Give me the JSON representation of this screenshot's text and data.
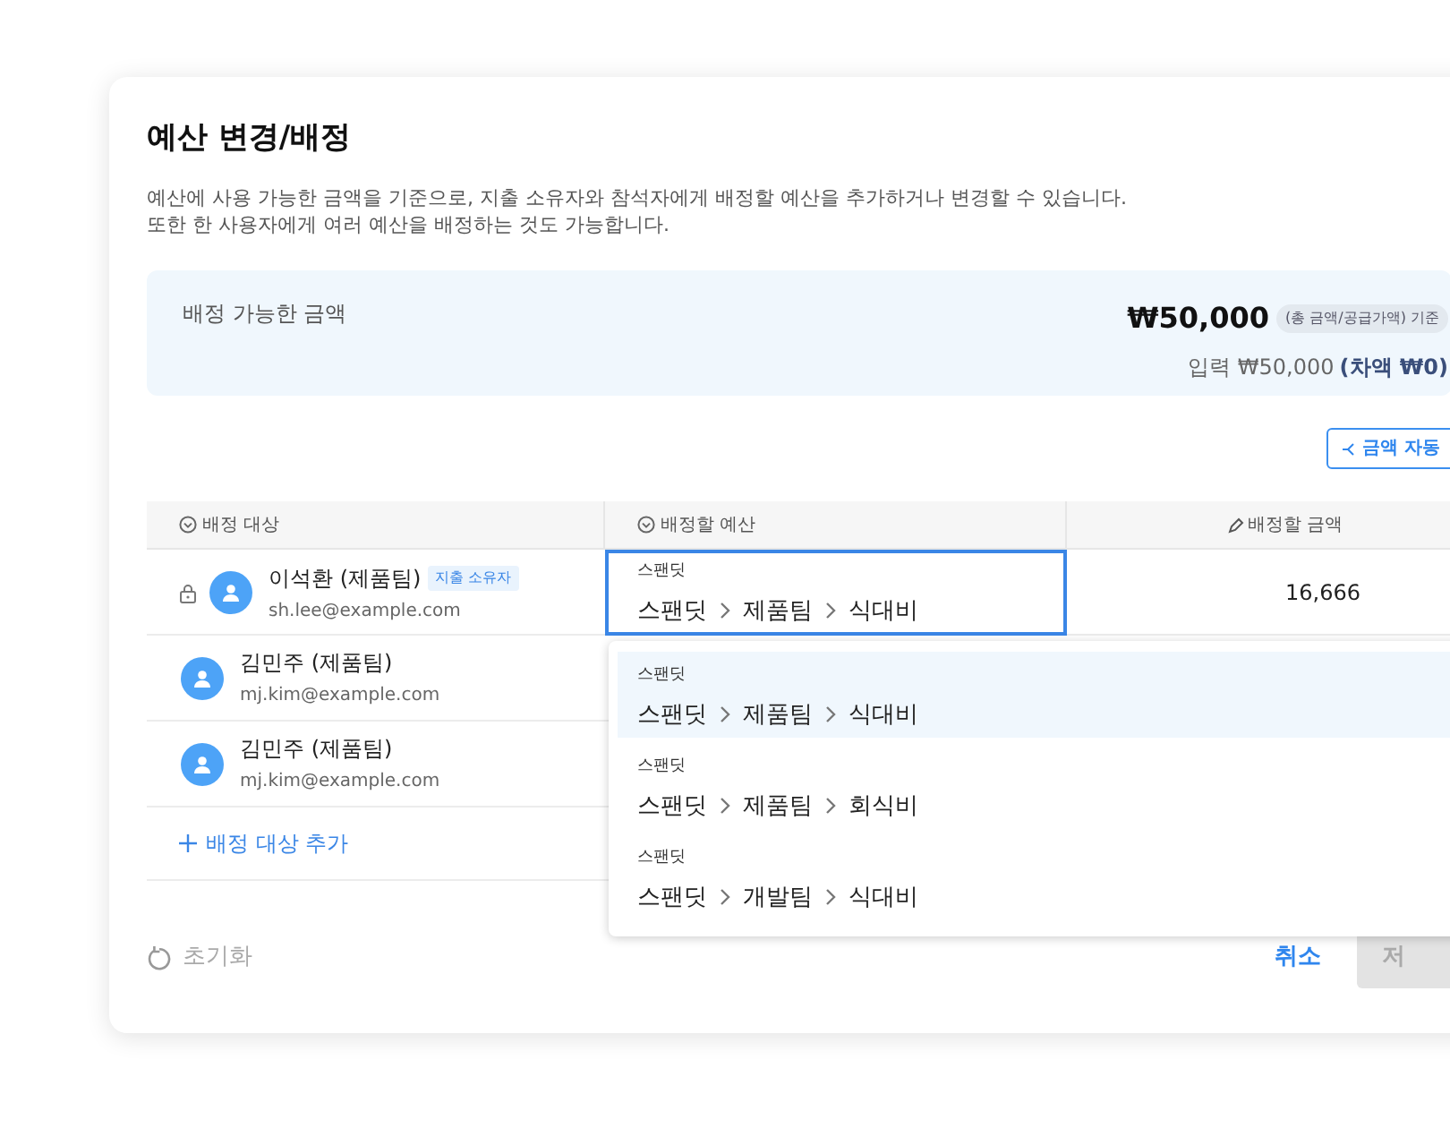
{
  "dialog": {
    "title": "예산 변경/배정",
    "description": [
      "예산에 사용 가능한 금액을 기준으로, 지출 소유자와 참석자에게 배정할 예산을 추가하거나 변경할 수 있습니다.",
      "또한 한 사용자에게 여러 예산을 배정하는 것도 가능합니다."
    ]
  },
  "summary": {
    "label": "배정 가능한 금액",
    "amount": "₩50,000",
    "basis": "(총 금액/공급가액) 기준",
    "input_text": "입력 ₩50,000",
    "difference": "(차액 ₩0)"
  },
  "auto_button": {
    "label": "금액 자동"
  },
  "table": {
    "columns": [
      "배정 대상",
      "배정할 예산",
      "배정할 금액"
    ],
    "rows": [
      {
        "locked": true,
        "name": "이석환 (제품팀)",
        "badge": "지출 소유자",
        "email": "sh.lee@example.com",
        "budget_org": "스팬딧",
        "budget_path": [
          "스팬딧",
          "제품팀",
          "식대비"
        ],
        "amount": "16,666"
      },
      {
        "locked": false,
        "name": "김민주 (제품팀)",
        "email": "mj.kim@example.com"
      },
      {
        "locked": false,
        "name": "김민주 (제품팀)",
        "email": "mj.kim@example.com"
      }
    ],
    "add_label": "배정 대상 추가"
  },
  "dropdown": {
    "options": [
      {
        "org": "스팬딧",
        "path": [
          "스팬딧",
          "제품팀",
          "식대비"
        ],
        "selected": true
      },
      {
        "org": "스팬딧",
        "path": [
          "스팬딧",
          "제품팀",
          "회식비"
        ],
        "selected": false
      },
      {
        "org": "스팬딧",
        "path": [
          "스팬딧",
          "개발팀",
          "식대비"
        ],
        "selected": false
      }
    ]
  },
  "footer": {
    "reset": "초기화",
    "cancel": "취소",
    "save": "저",
    "save_disabled": true
  }
}
